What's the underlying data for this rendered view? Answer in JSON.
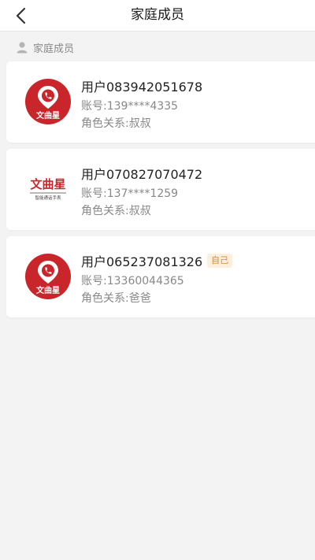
{
  "header": {
    "title": "家庭成员",
    "back_icon": "chevron-left-icon"
  },
  "section": {
    "label": "家庭成员",
    "icon": "person-icon"
  },
  "members": [
    {
      "name": "用户083942051678",
      "account": "账号:139****4335",
      "role": "角色关系:叔叔",
      "avatar": "red-phone-pin-logo",
      "logo_text": "文曲星",
      "badge": null
    },
    {
      "name": "用户070827070472",
      "account": "账号:137****1259",
      "role": "角色关系:叔叔",
      "avatar": "text-logo",
      "logo_text": "文曲星",
      "logo_subtext": "智能通话手表",
      "badge": null
    },
    {
      "name": "用户065237081326",
      "account": "账号:13360044365",
      "role": "角色关系:爸爸",
      "avatar": "red-phone-pin-logo",
      "logo_text": "文曲星",
      "badge": "自己"
    }
  ],
  "colors": {
    "background": "#f3f3f3",
    "card": "#ffffff",
    "brand_red": "#c8262a",
    "badge_text": "#d08a3a",
    "badge_bg": "#fdefdc"
  }
}
